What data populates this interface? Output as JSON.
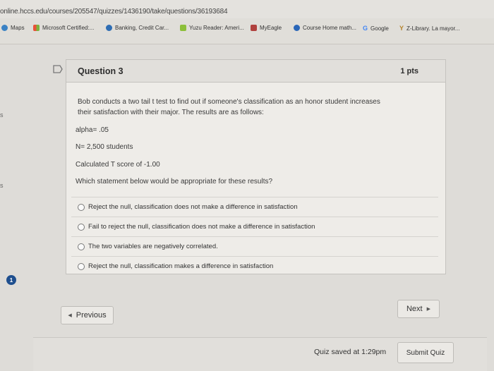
{
  "browser": {
    "url": "online.hccs.edu/courses/205547/quizzes/1436190/take/questions/36193684",
    "bookmarks": [
      {
        "label": "Maps",
        "color": "#3b82c4"
      },
      {
        "label": "Microsoft Certified:...",
        "color": "#5b9c3a"
      },
      {
        "label": "Banking, Credit Car...",
        "color": "#2e6db3"
      },
      {
        "label": "Yuzu Reader: Ameri...",
        "color": "#8cbf3a"
      },
      {
        "label": "MyEagle",
        "color": "#b0413e"
      },
      {
        "label": "Course Home math...",
        "color": "#2a66b8"
      },
      {
        "label": "Google",
        "color": "#4285f4"
      },
      {
        "label": "Z-Library. La mayor...",
        "color": "#b4832b"
      }
    ]
  },
  "sidebar": {
    "badge_count": "1"
  },
  "question": {
    "title": "Question 3",
    "points": "1 pts",
    "prompt_line1": "Bob conducts a two tail t test to find out if someone's classification as an honor student increases",
    "prompt_line2": "their satisfaction with their major.  The results are as follows:",
    "alpha": "alpha= .05",
    "n": "N= 2,500 students",
    "tscore": "Calculated T score of -1.00",
    "ask": "Which statement below would be appropriate for these results?",
    "options": [
      "Reject the null, classification does not make a difference in satisfaction",
      "Fail to reject the null, classification does not make a difference in satisfaction",
      "The two variables are negatively correlated.",
      "Reject the null, classification makes a difference in satisfaction"
    ]
  },
  "nav": {
    "previous": "Previous",
    "next": "Next"
  },
  "footer": {
    "saved": "Quiz saved at 1:29pm",
    "submit": "Submit Quiz"
  }
}
